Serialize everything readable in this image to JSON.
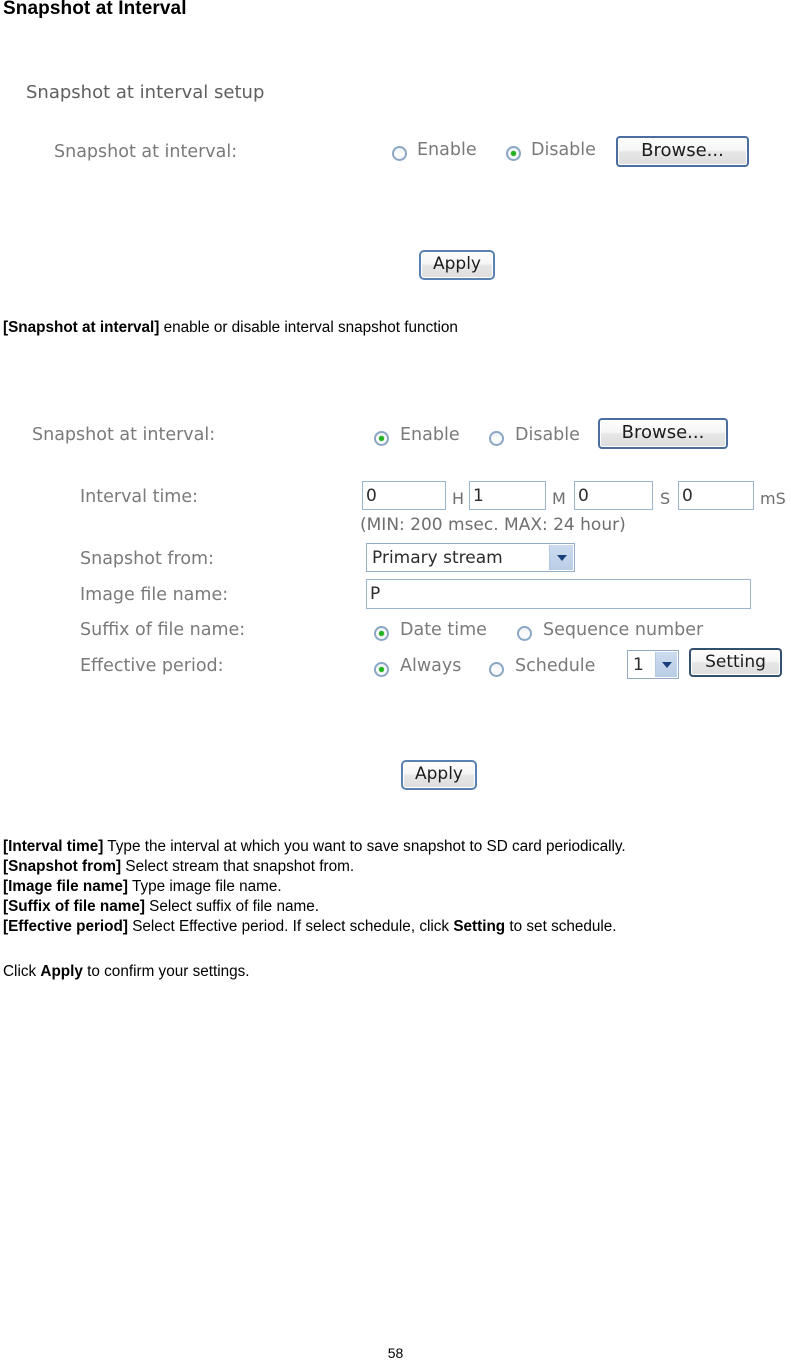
{
  "page": {
    "title": "Snapshot at Interval",
    "number": "58"
  },
  "panel1": {
    "section_title": "Snapshot at interval setup",
    "row_label": "Snapshot at interval:",
    "enable_label": "Enable",
    "disable_label": "Disable",
    "selected": "Disable",
    "browse_label": "Browse...",
    "apply_label": "Apply"
  },
  "desc1": {
    "term": "[Snapshot at interval]",
    "text": " enable or disable interval snapshot function"
  },
  "panel2": {
    "row_label": "Snapshot at interval:",
    "enable_label": "Enable",
    "disable_label": "Disable",
    "selected": "Enable",
    "browse_label": "Browse...",
    "interval_label": "Interval time:",
    "interval": {
      "hours": "0",
      "hours_unit": "H",
      "minutes": "1",
      "minutes_unit": "M",
      "seconds": "0",
      "seconds_unit": "S",
      "millis": "0",
      "millis_unit": "mS"
    },
    "interval_hint": "(MIN: 200 msec. MAX: 24 hour)",
    "snapshot_from_label": "Snapshot from:",
    "snapshot_from_value": "Primary stream",
    "image_file_name_label": "Image file name:",
    "image_file_name_value": "P",
    "suffix_label": "Suffix of file name:",
    "suffix_date_time": "Date time",
    "suffix_sequence": "Sequence number",
    "suffix_selected": "Date time",
    "effective_label": "Effective period:",
    "effective_always": "Always",
    "effective_schedule": "Schedule",
    "effective_selected": "Always",
    "schedule_value": "1",
    "setting_label": "Setting",
    "apply_label": "Apply"
  },
  "desc2": {
    "lines": [
      {
        "term": "[Interval time]",
        "text": " Type the interval at which you want to save snapshot to SD card periodically."
      },
      {
        "term": "[Snapshot from]",
        "text": " Select stream that snapshot from."
      },
      {
        "term": "[Image file name]",
        "text": " Type image file name."
      },
      {
        "term": "[Suffix of file name]",
        "text": " Select suffix of file name."
      },
      {
        "term": "[Effective period]",
        "text": " Select Effective period. If select schedule, click "
      },
      {
        "term": "Setting",
        "text": " to set schedule."
      }
    ],
    "effective_pre": "[Effective period]",
    "effective_mid": " Select Effective period. If select schedule, click ",
    "effective_bold": "Setting",
    "effective_post": " to set schedule.",
    "click_pre": "Click ",
    "click_bold": "Apply",
    "click_post": " to confirm your settings."
  },
  "colors": {
    "accent": "#4a6f9e",
    "radio_dot": "#21b421",
    "label_gray": "#7a7a7a"
  }
}
